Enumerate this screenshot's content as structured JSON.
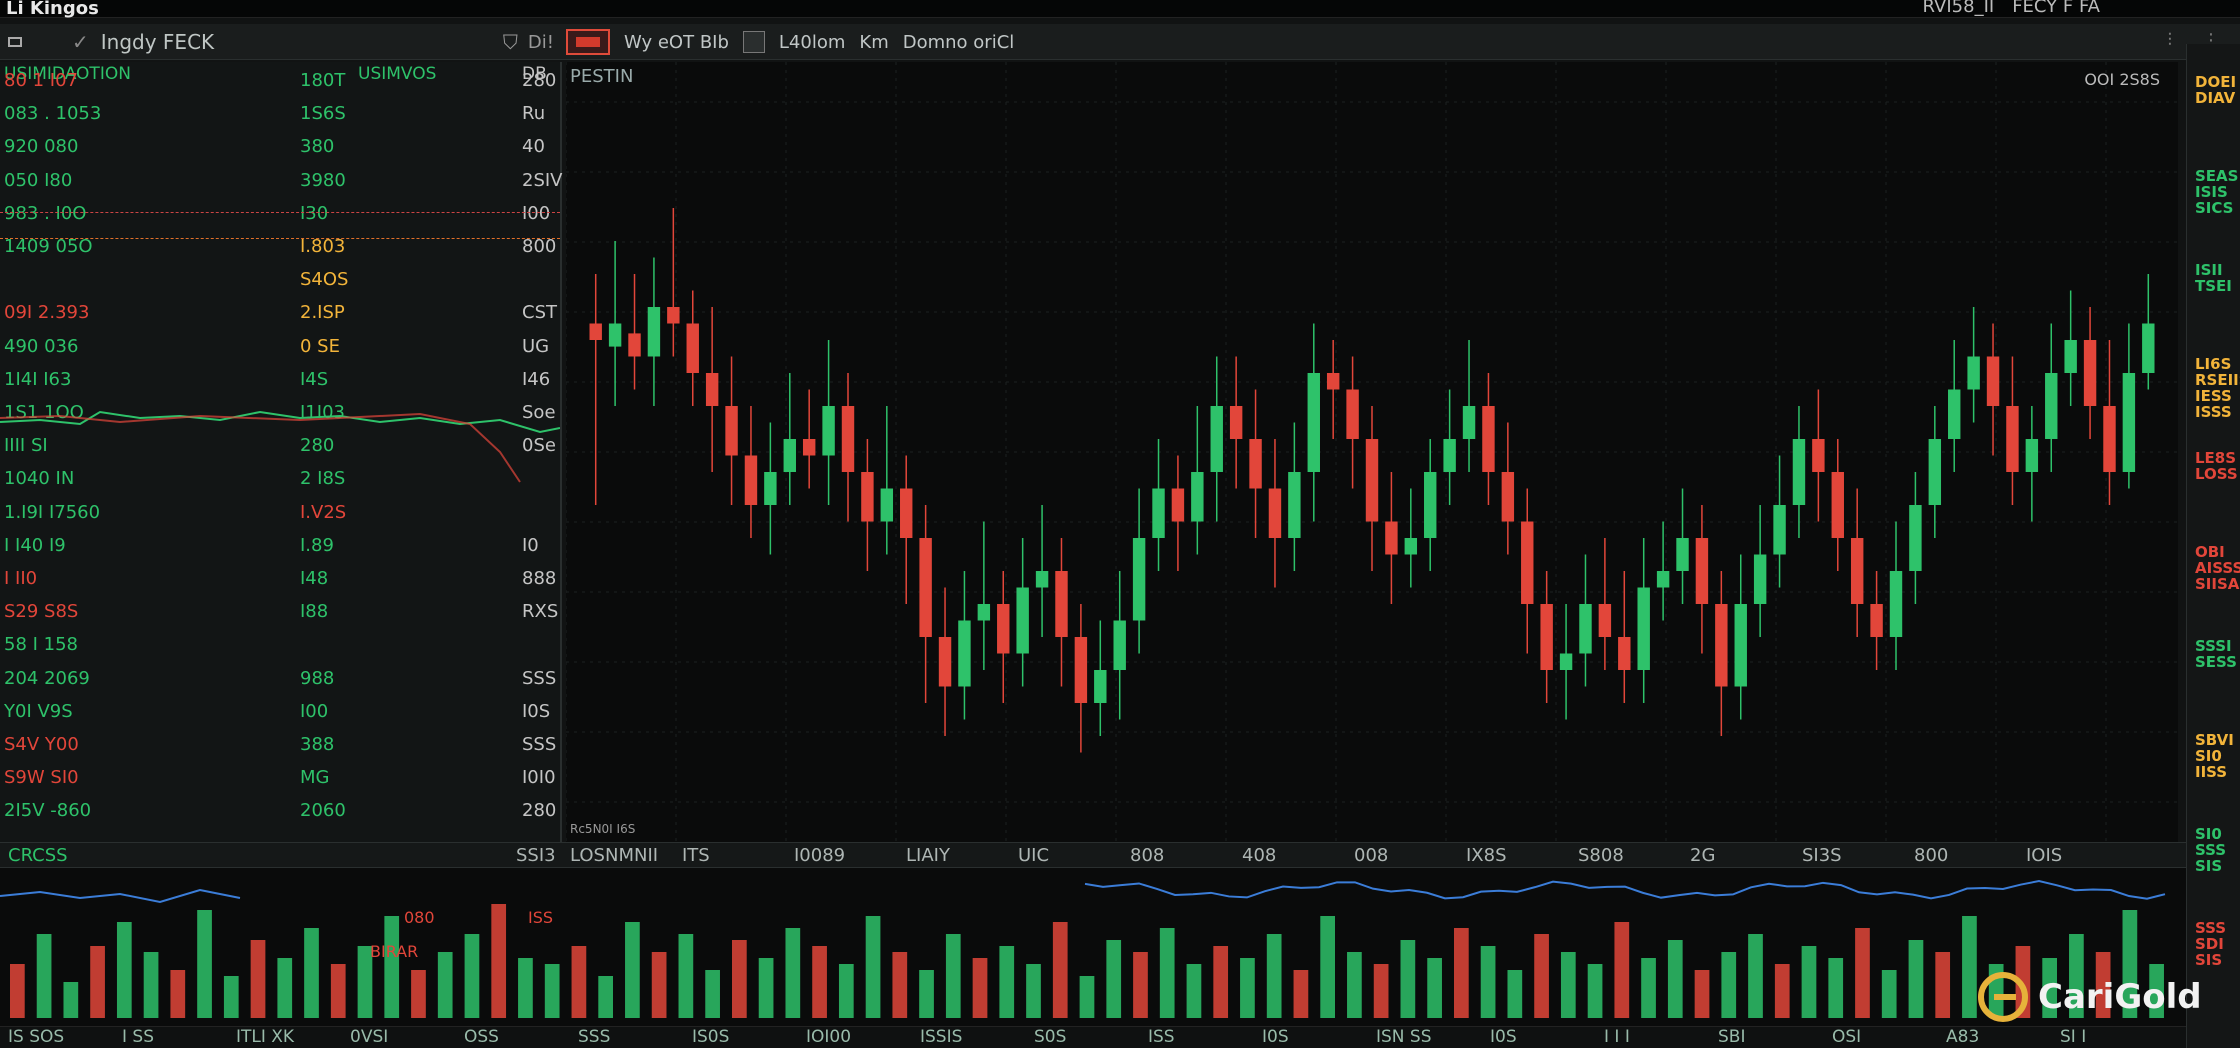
{
  "app": {
    "title": "Li Kingos"
  },
  "topbar": {
    "items": [
      "RVI58_II",
      "FECY F FA"
    ]
  },
  "toolbar": {
    "title": "Ingdy FECK",
    "left_extra": "Di!",
    "mid": [
      "Wy eOT BIb",
      "L40lom",
      "Km",
      "Domno oriCl"
    ]
  },
  "left_panel": {
    "header_left": "USIMIDAOTION",
    "header_mid": "USIMVOS",
    "header_right": "DB",
    "rows": [
      {
        "a": "80 1 I07",
        "b": "180T",
        "c": "280",
        "ca": "r",
        "cb": "g"
      },
      {
        "a": "083 . 1053",
        "b": "1S6S",
        "c": "Ru",
        "ca": "g",
        "cb": "g"
      },
      {
        "a": "920   080",
        "b": "380",
        "c": "40",
        "ca": "g",
        "cb": "g"
      },
      {
        "a": "050   I80",
        "b": "3980",
        "c": "2SIV",
        "ca": "g",
        "cb": "g"
      },
      {
        "a": "983 . I0O",
        "b": "I30",
        "c": "I00",
        "ca": "g",
        "cb": "g"
      },
      {
        "a": "1409   05O",
        "b": "I.803",
        "c": "800",
        "ca": "g",
        "cb": "y"
      },
      {
        "a": "",
        "b": "S4OS",
        "c": "",
        "ca": "g",
        "cb": "y"
      },
      {
        "a": "09I   2.393",
        "b": "2.ISP",
        "c": "CST",
        "ca": "r",
        "cb": "y"
      },
      {
        "a": "490   036",
        "b": "0 SE",
        "c": "UG",
        "ca": "g",
        "cb": "y"
      },
      {
        "a": "1I4I   I63",
        "b": "I4S",
        "c": "I46",
        "ca": "g",
        "cb": "g"
      },
      {
        "a": "1S1   1OO",
        "b": "I1I03",
        "c": "Soe",
        "ca": "g",
        "cb": "g"
      },
      {
        "a": "IIII   SI",
        "b": "280",
        "c": "0Se",
        "ca": "g",
        "cb": "g"
      },
      {
        "a": "1040   IN",
        "b": "2 I8S",
        "c": "",
        "ca": "g",
        "cb": "g"
      },
      {
        "a": "1.I9I   I7560",
        "b": "I.V2S",
        "c": "",
        "ca": "g",
        "cb": "r"
      },
      {
        "a": "I I40   I9",
        "b": "I.89",
        "c": "I0",
        "ca": "g",
        "cb": "g"
      },
      {
        "a": "I II0",
        "b": "I48",
        "c": "888",
        "ca": "r",
        "cb": "g"
      },
      {
        "a": "S29   S8S",
        "b": "I88",
        "c": "RXS",
        "ca": "r",
        "cb": "g"
      },
      {
        "a": "58 I   158",
        "b": "",
        "c": "",
        "ca": "g",
        "cb": "g"
      },
      {
        "a": "204   2069",
        "b": "988",
        "c": "SSS",
        "ca": "g",
        "cb": "g"
      },
      {
        "a": "Y0I   V9S",
        "b": "I00",
        "c": "I0S",
        "ca": "g",
        "cb": "g"
      },
      {
        "a": "S4V   Y00",
        "b": "388",
        "c": "SSS",
        "ca": "r",
        "cb": "g"
      },
      {
        "a": "S9W   SI0",
        "b": "MG",
        "c": "I0I0",
        "ca": "r",
        "cb": "g"
      },
      {
        "a": "2I5V   -860",
        "b": "2060",
        "c": "280",
        "ca": "g",
        "cb": "g"
      }
    ]
  },
  "main": {
    "symbol": "PESTIN",
    "price_label": "OOI 2S8S",
    "bottom_label": "Rc5N0I I6S"
  },
  "bottom_strip": {
    "labels": [
      "LOSNMNII",
      "ITS",
      "I0089",
      "LIAIY",
      "UIC",
      "808",
      "408",
      "008",
      "IX8S",
      "S808",
      "2G",
      "SI3S",
      "800",
      "IOIS"
    ],
    "left_labels": [
      "CRCSS",
      "SSI3"
    ]
  },
  "vol_panel": {
    "labels": [
      "080",
      "ISS",
      "BIRAR"
    ]
  },
  "footer": {
    "labels": [
      "IS   SOS",
      "I SS",
      "ITLI XK",
      "0VSI",
      "OSS",
      "SSS",
      "IS0S",
      "IOI00",
      "ISSIS",
      "S0S",
      "ISS",
      "I0S",
      "ISN SS",
      "I0S",
      "I I I",
      "SBI",
      "OSI",
      "A83",
      "SI I"
    ]
  },
  "right_panel": {
    "badges": [
      {
        "t": "DOEI\nDIAV",
        "c": "#f2b43a"
      },
      {
        "t": "SEAS\nISIS\nSICS",
        "c": "#2ec26a"
      },
      {
        "t": "ISII\nTSEI",
        "c": "#2ec26a"
      },
      {
        "t": "LI6S\nRSEIIS\nIESS\nISSS",
        "c": "#f2b43a"
      },
      {
        "t": "LE8S\nLOSS",
        "c": "#e2463a"
      },
      {
        "t": "OBI\nAISSS\nSIISA",
        "c": "#e2463a"
      },
      {
        "t": "SSSI\nSESS",
        "c": "#2ec26a"
      },
      {
        "t": "SBVI\nSI0\nIISS",
        "c": "#f2b43a"
      },
      {
        "t": "SI0\nSSS\nSIS",
        "c": "#2ec26a"
      },
      {
        "t": "SSS\nSDI\nSIS",
        "c": "#e2463a"
      }
    ]
  },
  "brand": {
    "name": "CariGold"
  },
  "colors": {
    "up": "#2ec26a",
    "down": "#e2463a",
    "accent": "#f2b43a",
    "line": "#3b7dd8"
  },
  "chart_data": {
    "type": "candlestick",
    "series": [
      {
        "values": [
          [
            345,
            340,
            290,
            360
          ],
          [
            338,
            345,
            320,
            370
          ],
          [
            342,
            335,
            325,
            360
          ],
          [
            335,
            350,
            320,
            365
          ],
          [
            350,
            345,
            335,
            380
          ],
          [
            345,
            330,
            320,
            355
          ],
          [
            330,
            320,
            300,
            350
          ],
          [
            320,
            305,
            290,
            335
          ],
          [
            305,
            290,
            280,
            320
          ],
          [
            290,
            300,
            275,
            315
          ],
          [
            300,
            310,
            290,
            330
          ],
          [
            310,
            305,
            295,
            325
          ],
          [
            305,
            320,
            290,
            340
          ],
          [
            320,
            300,
            285,
            330
          ],
          [
            300,
            285,
            270,
            310
          ],
          [
            285,
            295,
            275,
            320
          ],
          [
            295,
            280,
            260,
            305
          ],
          [
            280,
            250,
            230,
            290
          ],
          [
            250,
            235,
            220,
            265
          ],
          [
            235,
            255,
            225,
            270
          ],
          [
            255,
            260,
            240,
            285
          ],
          [
            260,
            245,
            230,
            270
          ],
          [
            245,
            265,
            235,
            280
          ],
          [
            265,
            270,
            250,
            290
          ],
          [
            270,
            250,
            235,
            280
          ],
          [
            250,
            230,
            215,
            260
          ],
          [
            230,
            240,
            220,
            255
          ],
          [
            240,
            255,
            225,
            270
          ],
          [
            255,
            280,
            245,
            295
          ],
          [
            280,
            295,
            270,
            310
          ],
          [
            295,
            285,
            270,
            305
          ],
          [
            285,
            300,
            275,
            320
          ],
          [
            300,
            320,
            285,
            335
          ],
          [
            320,
            310,
            295,
            335
          ],
          [
            310,
            295,
            280,
            325
          ],
          [
            295,
            280,
            265,
            310
          ],
          [
            280,
            300,
            270,
            315
          ],
          [
            300,
            330,
            285,
            345
          ],
          [
            330,
            325,
            310,
            340
          ],
          [
            325,
            310,
            295,
            335
          ],
          [
            310,
            285,
            270,
            320
          ],
          [
            285,
            275,
            260,
            300
          ],
          [
            275,
            280,
            265,
            295
          ],
          [
            280,
            300,
            270,
            310
          ],
          [
            300,
            310,
            290,
            325
          ],
          [
            310,
            320,
            300,
            340
          ],
          [
            320,
            300,
            290,
            330
          ],
          [
            300,
            285,
            275,
            315
          ],
          [
            285,
            260,
            245,
            295
          ],
          [
            260,
            240,
            230,
            270
          ],
          [
            240,
            245,
            225,
            260
          ],
          [
            245,
            260,
            235,
            275
          ],
          [
            260,
            250,
            240,
            280
          ],
          [
            250,
            240,
            230,
            270
          ],
          [
            240,
            265,
            230,
            280
          ],
          [
            265,
            270,
            255,
            285
          ],
          [
            270,
            280,
            260,
            295
          ],
          [
            280,
            260,
            245,
            290
          ],
          [
            260,
            235,
            220,
            270
          ],
          [
            235,
            260,
            225,
            275
          ],
          [
            260,
            275,
            250,
            290
          ],
          [
            275,
            290,
            265,
            305
          ],
          [
            290,
            310,
            280,
            320
          ],
          [
            310,
            300,
            285,
            325
          ],
          [
            300,
            280,
            270,
            310
          ],
          [
            280,
            260,
            250,
            295
          ],
          [
            260,
            250,
            240,
            270
          ],
          [
            250,
            270,
            240,
            285
          ],
          [
            270,
            290,
            260,
            300
          ],
          [
            290,
            310,
            280,
            320
          ],
          [
            310,
            325,
            300,
            340
          ],
          [
            325,
            335,
            315,
            350
          ],
          [
            335,
            320,
            305,
            345
          ],
          [
            320,
            300,
            290,
            335
          ],
          [
            300,
            310,
            285,
            320
          ],
          [
            310,
            330,
            300,
            345
          ],
          [
            330,
            340,
            320,
            355
          ],
          [
            340,
            320,
            310,
            350
          ],
          [
            320,
            300,
            290,
            340
          ],
          [
            300,
            330,
            295,
            345
          ],
          [
            330,
            345,
            325,
            360
          ]
        ]
      }
    ],
    "volume": [
      45,
      70,
      30,
      60,
      80,
      55,
      40,
      90,
      35,
      65,
      50,
      75,
      45,
      60,
      85,
      40,
      55,
      70,
      95,
      50,
      45,
      60,
      35,
      80,
      55,
      70,
      40,
      65,
      50,
      75,
      60,
      45,
      85,
      55,
      40,
      70,
      50,
      60,
      45,
      80,
      35,
      65,
      55,
      75,
      45,
      60,
      50,
      70,
      40,
      85,
      55,
      45,
      65,
      50,
      75,
      60,
      40,
      70,
      55,
      45,
      80,
      50,
      65,
      40,
      55,
      70,
      45,
      60,
      50,
      75,
      40,
      65,
      55,
      85,
      45,
      60,
      50,
      70,
      55,
      90,
      45
    ]
  }
}
